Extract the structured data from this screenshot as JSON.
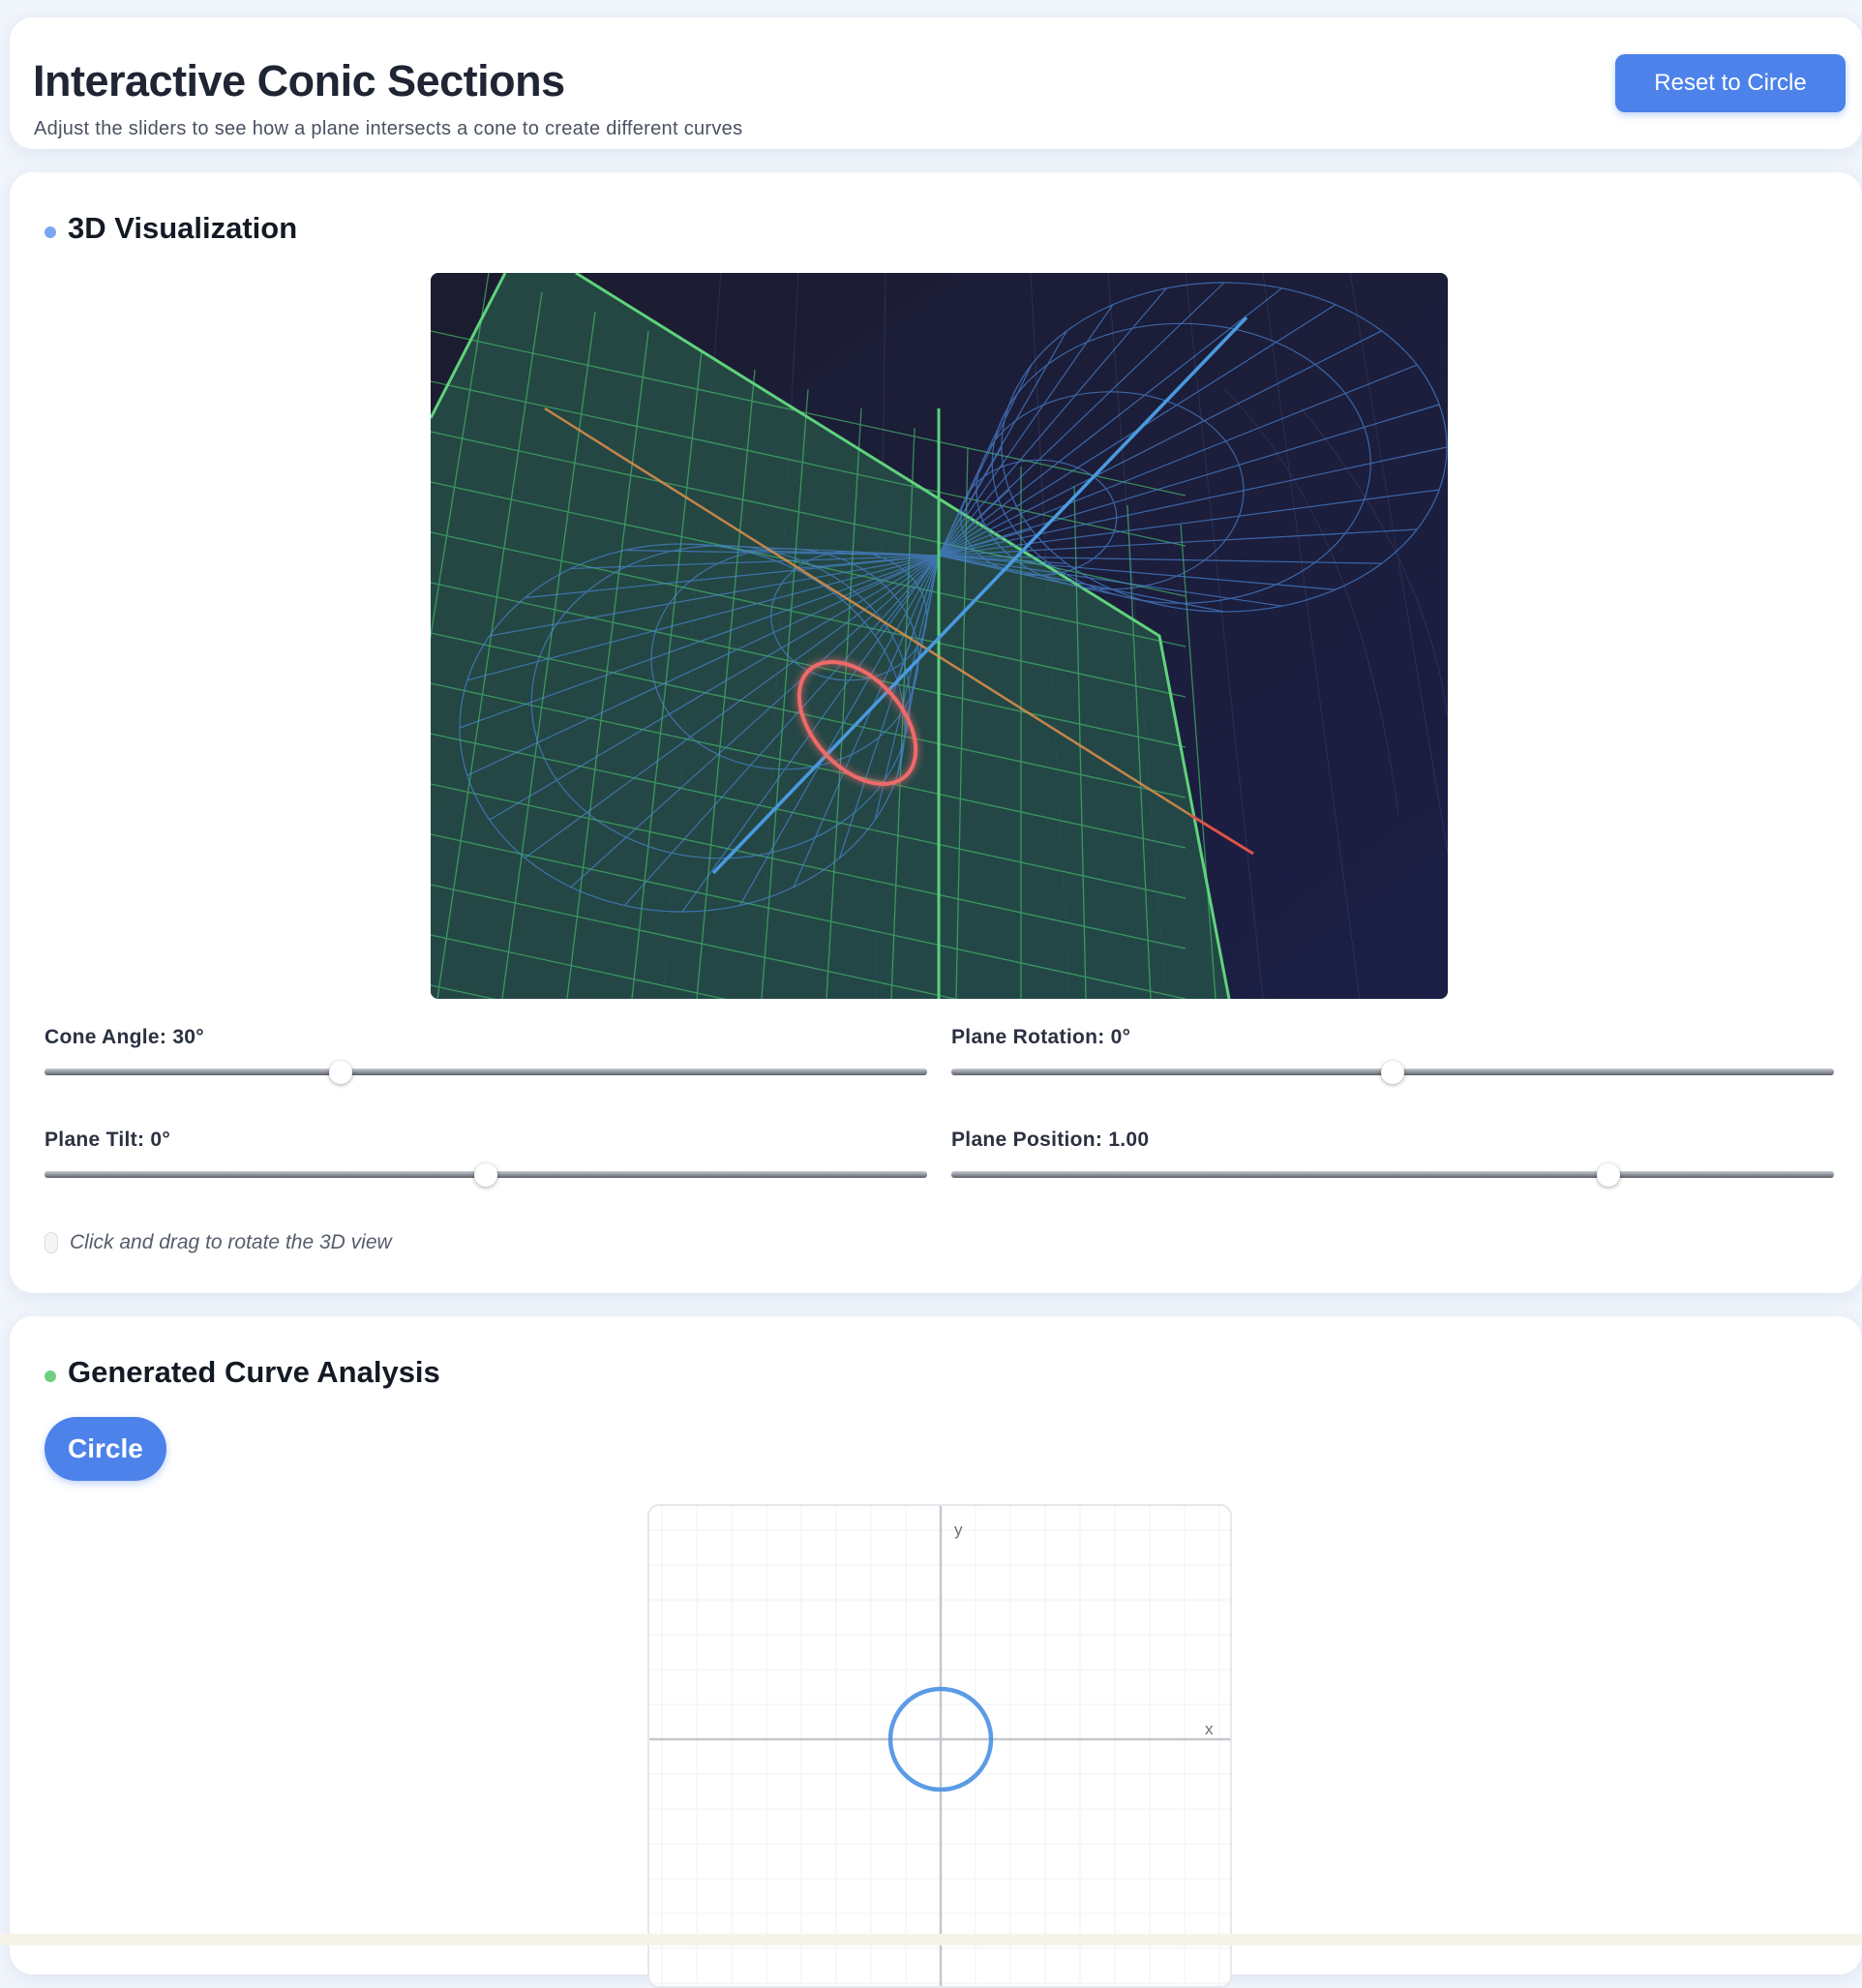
{
  "header": {
    "title": "Interactive Conic Sections",
    "subtitle": "Adjust the sliders to see how a plane intersects a cone to create different curves",
    "reset_label": "Reset to Circle"
  },
  "visualization": {
    "section_title": "3D Visualization",
    "section_dot_color": "#7aa6f0",
    "hint": "Click and drag to rotate the 3D view",
    "sliders": [
      {
        "id": "cone-angle",
        "label": "Cone Angle: 30°",
        "value": 30,
        "fraction": 0.335
      },
      {
        "id": "plane-rotation",
        "label": "Plane Rotation: 0°",
        "value": 0,
        "fraction": 0.5
      },
      {
        "id": "plane-tilt",
        "label": "Plane Tilt: 0°",
        "value": 0,
        "fraction": 0.5
      },
      {
        "id": "plane-position",
        "label": "Plane Position: 1.00",
        "value": 1.0,
        "fraction": 0.745
      }
    ],
    "colors": {
      "background": "#1b1d33",
      "cone": "#4a8ee0",
      "plane": "#4cc46b",
      "intersection": "#f06a6a",
      "axis_x": "#e0524a",
      "axis_y": "#4cc46b",
      "axis_z": "#4a9ae0"
    }
  },
  "analysis": {
    "section_title": "Generated Curve Analysis",
    "section_dot_color": "#6fcf7f",
    "curve_type": "Circle",
    "plot": {
      "x_label": "x",
      "y_label": "y",
      "curve_color": "#4a90e2"
    }
  }
}
